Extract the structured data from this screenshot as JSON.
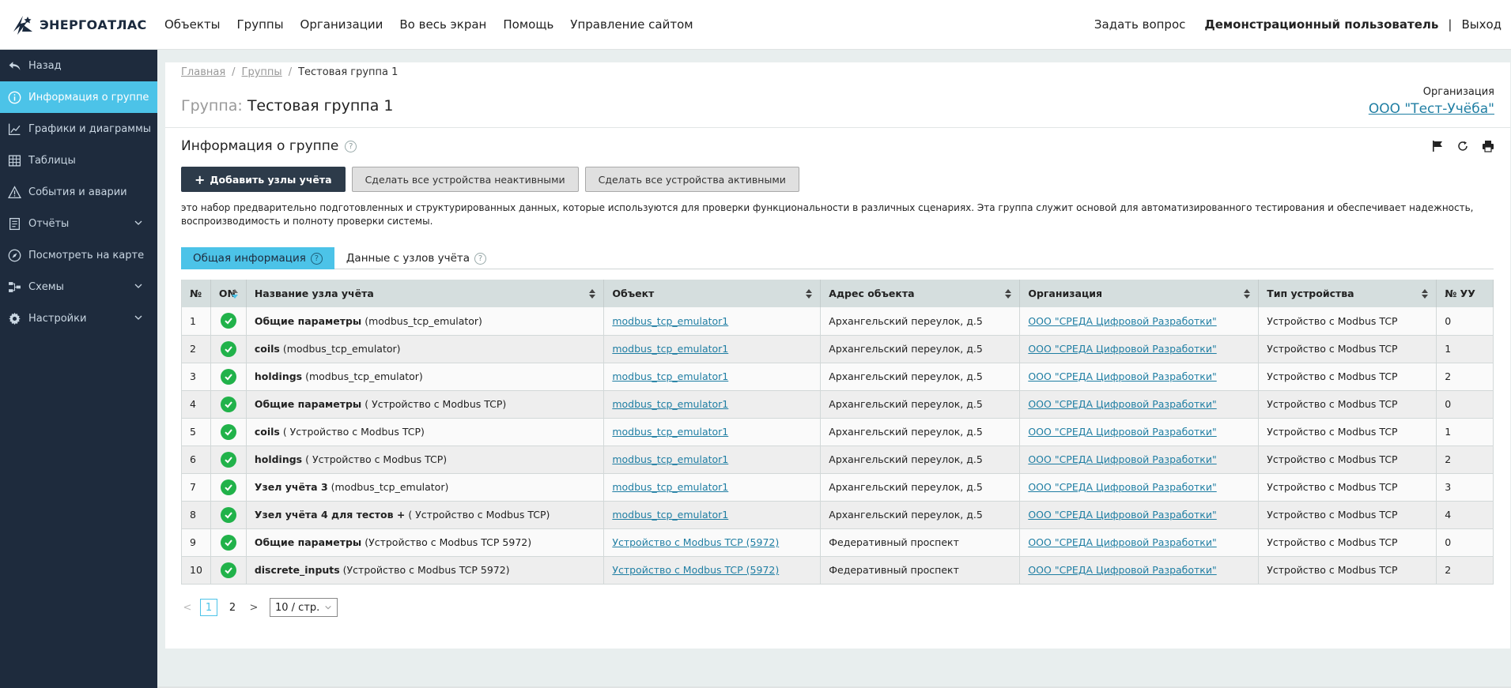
{
  "app": {
    "logo_text": "ЭНЕРГОАТЛАС"
  },
  "topnav": [
    "Объекты",
    "Группы",
    "Организации",
    "Во весь экран",
    "Помощь",
    "Управление сайтом"
  ],
  "topright": {
    "ask": "Задать вопрос",
    "user": "Демонстрационный пользователь",
    "sep": "|",
    "logout": "Выход"
  },
  "sidebar": {
    "items": [
      {
        "label": "Назад",
        "icon": "back-icon"
      },
      {
        "label": "Информация о группе",
        "icon": "info-icon",
        "active": true
      },
      {
        "label": "Графики и диаграммы",
        "icon": "chart-icon"
      },
      {
        "label": "Таблицы",
        "icon": "table-icon"
      },
      {
        "label": "События и аварии",
        "icon": "warning-icon"
      },
      {
        "label": "Отчёты",
        "icon": "report-icon",
        "expandable": true
      },
      {
        "label": "Посмотреть на карте",
        "icon": "compass-icon"
      },
      {
        "label": "Схемы",
        "icon": "schema-icon",
        "expandable": true
      },
      {
        "label": "Настройки",
        "icon": "gear-icon",
        "expandable": true
      }
    ]
  },
  "breadcrumb": {
    "home": "Главная",
    "groups": "Группы",
    "current": "Тестовая группа 1",
    "sep": "/"
  },
  "page": {
    "title_prefix": "Группа:",
    "title": "Тестовая группа 1"
  },
  "org": {
    "label": "Организация",
    "name": "ООО \"Тест-Учёба\""
  },
  "section": {
    "title": "Информация о группе",
    "help": "?"
  },
  "buttons": {
    "add": "Добавить узлы учёта",
    "deactivate": "Сделать все устройства неактивными",
    "activate": "Сделать все устройства активными"
  },
  "description": "это набор предварительно подготовленных и структурированных данных, которые используются для проверки функциональности в различных сценариях. Эта группа служит основой для автоматизированного тестирования и обеспечивает надежность, воспроизводимость и полноту проверки системы.",
  "tabs": [
    {
      "label": "Общая информация",
      "active": true
    },
    {
      "label": "Данные с узлов учёта",
      "active": false
    }
  ],
  "table": {
    "headers": [
      "№",
      "ON",
      "Название узла учёта",
      "Объект",
      "Адрес объекта",
      "Организация",
      "Тип устройства",
      "№ УУ"
    ],
    "rows": [
      {
        "n": "1",
        "name_bold": "Общие параметры",
        "name_rest": " (modbus_tcp_emulator)",
        "object": "modbus_tcp_emulator1",
        "address": "Архангельский переулок, д.5",
        "org": "ООО \"СРЕДА Цифровой Разработки\"",
        "type": "Устройство с Modbus TCP",
        "uu": "0"
      },
      {
        "n": "2",
        "name_bold": "coils",
        "name_rest": " (modbus_tcp_emulator)",
        "object": "modbus_tcp_emulator1",
        "address": "Архангельский переулок, д.5",
        "org": "ООО \"СРЕДА Цифровой Разработки\"",
        "type": "Устройство с Modbus TCP",
        "uu": "1"
      },
      {
        "n": "3",
        "name_bold": "holdings",
        "name_rest": " (modbus_tcp_emulator)",
        "object": "modbus_tcp_emulator1",
        "address": "Архангельский переулок, д.5",
        "org": "ООО \"СРЕДА Цифровой Разработки\"",
        "type": "Устройство с Modbus TCP",
        "uu": "2"
      },
      {
        "n": "4",
        "name_bold": "Общие параметры",
        "name_rest": " ( Устройство с Modbus TCP)",
        "object": "modbus_tcp_emulator1",
        "address": "Архангельский переулок, д.5",
        "org": "ООО \"СРЕДА Цифровой Разработки\"",
        "type": "Устройство с Modbus TCP",
        "uu": "0"
      },
      {
        "n": "5",
        "name_bold": "coils",
        "name_rest": " ( Устройство с Modbus TCP)",
        "object": "modbus_tcp_emulator1",
        "address": "Архангельский переулок, д.5",
        "org": "ООО \"СРЕДА Цифровой Разработки\"",
        "type": "Устройство с Modbus TCP",
        "uu": "1"
      },
      {
        "n": "6",
        "name_bold": "holdings",
        "name_rest": " ( Устройство с Modbus TCP)",
        "object": "modbus_tcp_emulator1",
        "address": "Архангельский переулок, д.5",
        "org": "ООО \"СРЕДА Цифровой Разработки\"",
        "type": "Устройство с Modbus TCP",
        "uu": "2"
      },
      {
        "n": "7",
        "name_bold": "Узел учёта 3",
        "name_rest": " (modbus_tcp_emulator)",
        "object": "modbus_tcp_emulator1",
        "address": "Архангельский переулок, д.5",
        "org": "ООО \"СРЕДА Цифровой Разработки\"",
        "type": "Устройство с Modbus TCP",
        "uu": "3"
      },
      {
        "n": "8",
        "name_bold": "Узел учёта 4 для тестов +",
        "name_rest": " ( Устройство с Modbus TCP)",
        "object": "modbus_tcp_emulator1",
        "address": "Архангельский переулок, д.5",
        "org": "ООО \"СРЕДА Цифровой Разработки\"",
        "type": "Устройство с Modbus TCP",
        "uu": "4"
      },
      {
        "n": "9",
        "name_bold": "Общие параметры",
        "name_rest": " (Устройство с Modbus TCP 5972)",
        "object": "Устройство с Modbus TCP (5972)",
        "address": "Федеративный проспект",
        "org": "ООО \"СРЕДА Цифровой Разработки\"",
        "type": "Устройство с Modbus TCP",
        "uu": "0"
      },
      {
        "n": "10",
        "name_bold": "discrete_inputs",
        "name_rest": " (Устройство с Modbus TCP 5972)",
        "object": "Устройство с Modbus TCP (5972)",
        "address": "Федеративный проспект",
        "org": "ООО \"СРЕДА Цифровой Разработки\"",
        "type": "Устройство с Modbus TCP",
        "uu": "2"
      }
    ]
  },
  "pager": {
    "prev": "<",
    "pages": [
      "1",
      "2"
    ],
    "current": "1",
    "next": ">",
    "size": "10 / стр."
  },
  "colors": {
    "accent": "#4cc3e8",
    "sidebar_bg": "#1e2b3d",
    "success": "#21b24a",
    "link": "#1f7ea3"
  }
}
